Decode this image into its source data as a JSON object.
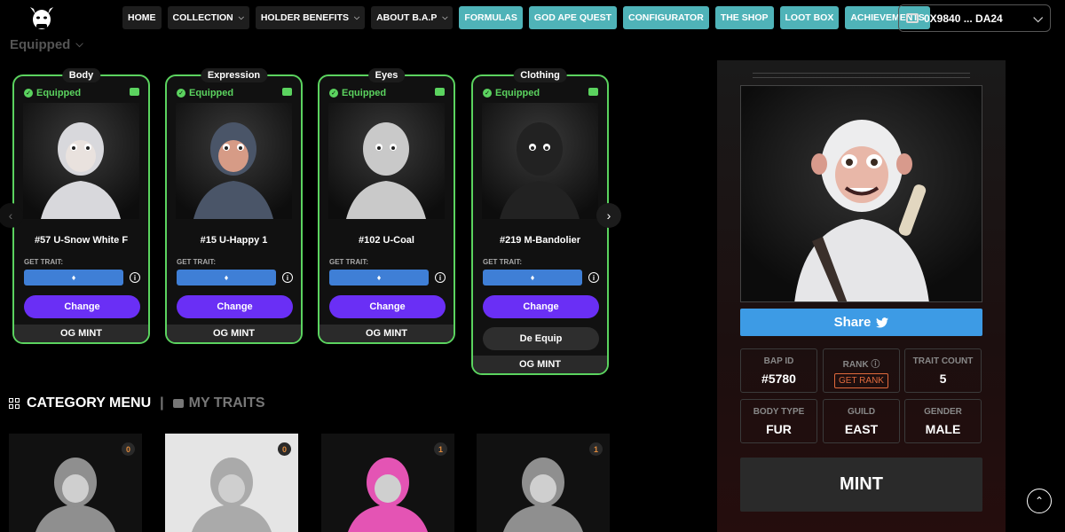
{
  "nav": {
    "logo": "bull-logo-icon",
    "items": [
      {
        "label": "HOME",
        "style": "dark",
        "dropdown": false
      },
      {
        "label": "COLLECTION",
        "style": "dark",
        "dropdown": true
      },
      {
        "label": "HOLDER BENEFITS",
        "style": "dark",
        "dropdown": true
      },
      {
        "label": "ABOUT B.A.P",
        "style": "dark",
        "dropdown": true
      },
      {
        "label": "FORMULAS",
        "style": "teal",
        "dropdown": false
      },
      {
        "label": "GOD APE QUEST",
        "style": "teal",
        "dropdown": false
      },
      {
        "label": "CONFIGURATOR",
        "style": "teal",
        "dropdown": false
      },
      {
        "label": "THE SHOP",
        "style": "teal",
        "dropdown": false
      },
      {
        "label": "LOOT BOX",
        "style": "teal",
        "dropdown": false
      },
      {
        "label": "ACHIEVEMENTS",
        "style": "teal",
        "dropdown": false
      }
    ],
    "wallet": "0X9840 ... DA24"
  },
  "equipped": {
    "title": "Equipped"
  },
  "cards": [
    {
      "category": "Body",
      "status": "Equipped",
      "name": "#57 U-Snow White F",
      "get_trait": "GET TRAIT:",
      "action": "Change",
      "footer": "OG MINT",
      "fur": "#d8d8dc",
      "skin": "#e9e2de"
    },
    {
      "category": "Expression",
      "status": "Equipped",
      "name": "#15 U-Happy 1",
      "get_trait": "GET TRAIT:",
      "action": "Change",
      "footer": "OG MINT",
      "fur": "#4a5568",
      "skin": "#d69b86"
    },
    {
      "category": "Eyes",
      "status": "Equipped",
      "name": "#102 U-Coal",
      "get_trait": "GET TRAIT:",
      "action": "Change",
      "footer": "OG MINT",
      "fur": "#c9c9c9",
      "skin": "#c9c9c9"
    },
    {
      "category": "Clothing",
      "status": "Equipped",
      "name": "#219 M-Bandolier",
      "get_trait": "GET TRAIT:",
      "action": "Change",
      "secondary": "De Equip",
      "footer": "OG MINT",
      "fur": "#222",
      "skin": "#222"
    }
  ],
  "category_menu": {
    "label": "CATEGORY MENU",
    "my_traits": "MY TRAITS"
  },
  "thumbs": [
    {
      "count": "0",
      "fur": "#8f8f8f",
      "bg": "#111"
    },
    {
      "count": "0",
      "fur": "#aaa",
      "bg": "#e5e5e5"
    },
    {
      "count": "1",
      "fur": "#e454b4",
      "bg": "#111"
    },
    {
      "count": "1",
      "fur": "#8f8f8f",
      "bg": "#111"
    }
  ],
  "details": {
    "share": "Share",
    "stats": [
      {
        "label": "BAP ID",
        "value": "#5780"
      },
      {
        "label": "RANK",
        "button": "GET RANK"
      },
      {
        "label": "TRAIT COUNT",
        "value": "5"
      },
      {
        "label": "BODY TYPE",
        "value": "FUR"
      },
      {
        "label": "GUILD",
        "value": "EAST"
      },
      {
        "label": "GENDER",
        "value": "MALE"
      }
    ],
    "mint": "MINT"
  }
}
